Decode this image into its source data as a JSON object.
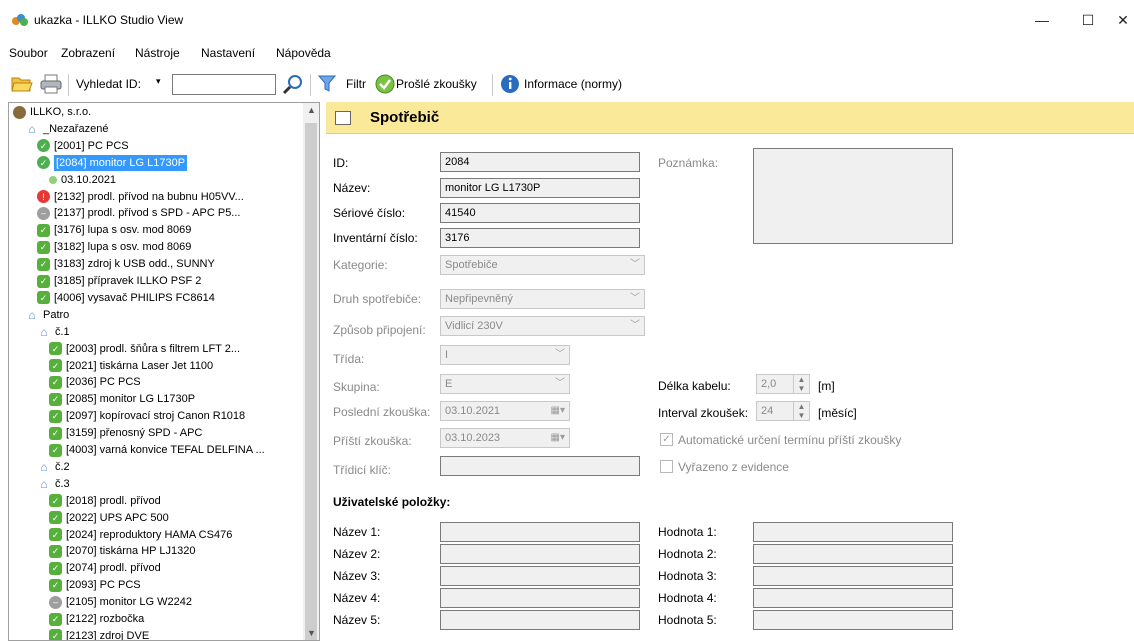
{
  "window": {
    "title": "ukazka - ILLKO Studio View",
    "minimize": "—",
    "maximize": "☐",
    "close": "✕"
  },
  "menu": [
    "Soubor",
    "Zobrazení",
    "Nástroje",
    "Nastavení",
    "Nápověda"
  ],
  "toolbar": {
    "search_label": "Vyhledat ID:",
    "search_value": "",
    "filter_label": "Filtr",
    "expired_label": "Prošlé zkoušky",
    "info_label": "Informace (normy)"
  },
  "tree": [
    {
      "text": "ILLKO, s.r.o.",
      "icon": "company"
    },
    {
      "text": "_Nezařazené",
      "icon": "house"
    },
    {
      "text": "[2001] PC PCS",
      "icon": "ok"
    },
    {
      "text": "[2084] monitor LG L1730P",
      "icon": "ok",
      "selected": true
    },
    {
      "text": "03.10.2021",
      "icon": "leaf"
    },
    {
      "text": "[2132] prodl. přívod na bubnu H05VV...",
      "icon": "err"
    },
    {
      "text": "[2137] prodl. přívod s SPD - APC P5...",
      "icon": "gray"
    },
    {
      "text": "[3176] lupa s osv. mod 8069",
      "icon": "okf"
    },
    {
      "text": "[3182] lupa s osv. mod 8069",
      "icon": "okf"
    },
    {
      "text": "[3183] zdroj k USB odd., SUNNY",
      "icon": "okf"
    },
    {
      "text": "[3185] přípravek ILLKO PSF 2",
      "icon": "okf"
    },
    {
      "text": "[4006] vysavač PHILIPS FC8614",
      "icon": "okf"
    },
    {
      "text": "Patro",
      "icon": "house"
    },
    {
      "text": "č.1",
      "icon": "house"
    },
    {
      "text": "[2003] prodl. šňůra s filtrem LFT 2...",
      "icon": "okf"
    },
    {
      "text": "[2021] tiskárna Laser Jet 1100",
      "icon": "okf"
    },
    {
      "text": "[2036] PC PCS",
      "icon": "okf"
    },
    {
      "text": "[2085] monitor LG L1730P",
      "icon": "okf"
    },
    {
      "text": "[2097] kopírovací stroj Canon R1018",
      "icon": "okf"
    },
    {
      "text": "[3159] přenosný SPD - APC",
      "icon": "okf"
    },
    {
      "text": "[4003] varná konvice TEFAL DELFINA ...",
      "icon": "okf"
    },
    {
      "text": "č.2",
      "icon": "house"
    },
    {
      "text": "č.3",
      "icon": "house"
    },
    {
      "text": "[2018] prodl. přívod",
      "icon": "okf"
    },
    {
      "text": "[2022] UPS APC 500",
      "icon": "okf"
    },
    {
      "text": "[2024] reproduktory HAMA CS476",
      "icon": "okf"
    },
    {
      "text": "[2070] tiskárna HP LJ1320",
      "icon": "okf"
    },
    {
      "text": "[2074] prodl. přívod",
      "icon": "okf"
    },
    {
      "text": "[2093] PC PCS",
      "icon": "okf"
    },
    {
      "text": "[2105] monitor LG W2242",
      "icon": "gray"
    },
    {
      "text": "[2122] rozbočka",
      "icon": "okf"
    },
    {
      "text": "[2123] zdroj DVE",
      "icon": "okf"
    }
  ],
  "panel": {
    "title": "Spotřebič"
  },
  "form": {
    "id_label": "ID:",
    "id_value": "2084",
    "name_label": "Název:",
    "name_value": "monitor LG L1730P",
    "serial_label": "Sériové číslo:",
    "serial_value": "41540",
    "inventory_label": "Inventární číslo:",
    "inventory_value": "3176",
    "category_label": "Kategorie:",
    "category_value": "Spotřebiče",
    "type_label": "Druh spotřebiče:",
    "type_value": "Nepřipevněný",
    "connection_label": "Způsob připojení:",
    "connection_value": "Vidlicí 230V",
    "class_label": "Třída:",
    "class_value": "I",
    "group_label": "Skupina:",
    "group_value": "E",
    "last_test_label": "Poslední zkouška:",
    "last_test_value": "03.10.2021",
    "next_test_label": "Příští zkouška:",
    "next_test_value": "03.10.2023",
    "sort_key_label": "Třídicí klíč:",
    "sort_key_value": "",
    "note_label": "Poznámka:",
    "note_value": "",
    "cable_label": "Délka kabelu:",
    "cable_value": "2,0",
    "cable_unit": "[m]",
    "interval_label": "Interval zkoušek:",
    "interval_value": "24",
    "interval_unit": "[měsíc]",
    "auto_label": "Automatické určení termínu příští zkoušky",
    "auto_checked": true,
    "retired_label": "Vyřazeno z evidence",
    "retired_checked": false
  },
  "user_items": {
    "heading": "Uživatelské položky:",
    "names": [
      "Název 1:",
      "Název 2:",
      "Název 3:",
      "Název 4:",
      "Název 5:"
    ],
    "values": [
      "Hodnota 1:",
      "Hodnota 2:",
      "Hodnota 3:",
      "Hodnota 4:",
      "Hodnota 5:"
    ]
  }
}
